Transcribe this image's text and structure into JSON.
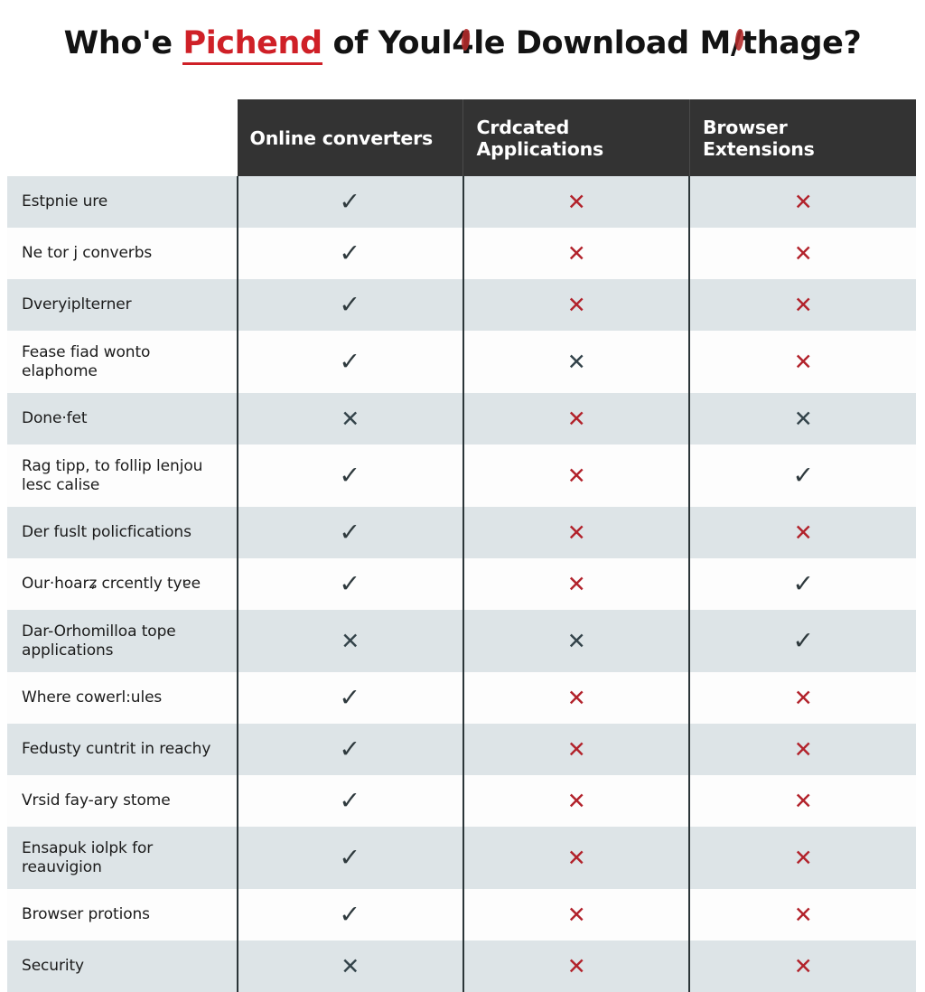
{
  "title": {
    "before": "Who'e ",
    "highlight": "Pichend",
    "middle": " of Youl",
    "smudge1": "4",
    "middle2": "le Download M",
    "smudge2": "/",
    "after": "thage?"
  },
  "table": {
    "columns": [
      {
        "id": "online-converters",
        "label": "Online converters"
      },
      {
        "id": "dedicated-applications",
        "label": "Crdcated Applications"
      },
      {
        "id": "browser-extensions",
        "label": "Browser Extensions"
      }
    ],
    "marks": {
      "check": "✓",
      "cross": "✕"
    },
    "colors": {
      "header_bg": "#333333",
      "row_alt_bg": "#dde4e7",
      "row_bg": "#fdfdfd",
      "cross_red": "#b2222b",
      "cross_dark": "#33434a",
      "check_dark": "#2e393d",
      "title_highlight": "#cf2027"
    },
    "rows": [
      {
        "label": "Estpnie ure",
        "values": [
          "check",
          "cross-red",
          "cross-red"
        ],
        "lines": 1
      },
      {
        "label": "Ne tor j converbs",
        "values": [
          "check",
          "cross-red",
          "cross-red"
        ],
        "lines": 1
      },
      {
        "label": "Dveryiplterner",
        "values": [
          "check",
          "cross-red",
          "cross-red"
        ],
        "lines": 1
      },
      {
        "label": "Fease fiad wonto elaphome",
        "values": [
          "check",
          "cross-dark",
          "cross-red"
        ],
        "lines": 2
      },
      {
        "label": "Done·fet",
        "values": [
          "cross-dark",
          "cross-red",
          "cross-dark"
        ],
        "lines": 1
      },
      {
        "label": "Rag tipp, to follip lenjou lesc calise",
        "values": [
          "check",
          "cross-red",
          "check"
        ],
        "lines": 2
      },
      {
        "label": "Der fuslt policfications",
        "values": [
          "check",
          "cross-red",
          "cross-red"
        ],
        "lines": 1
      },
      {
        "label": "Our·hoarʑ crcently tyɐe",
        "values": [
          "check",
          "cross-red",
          "check"
        ],
        "lines": 1
      },
      {
        "label": "Dar-Orhomilloa tope applications",
        "values": [
          "cross-dark",
          "cross-dark",
          "check"
        ],
        "lines": 2
      },
      {
        "label": "Where cowerl:ules",
        "values": [
          "check",
          "cross-red",
          "cross-red"
        ],
        "lines": 1
      },
      {
        "label": "Fedusty cuntrit in reachy",
        "values": [
          "check",
          "cross-red",
          "cross-red"
        ],
        "lines": 1
      },
      {
        "label": "Vrsid fay-ary stome",
        "values": [
          "check",
          "cross-red",
          "cross-red"
        ],
        "lines": 1
      },
      {
        "label": "Ensapuk iolpk for reauvigion",
        "values": [
          "check",
          "cross-red",
          "cross-red"
        ],
        "lines": 2
      },
      {
        "label": "Browser protions",
        "values": [
          "check",
          "cross-red",
          "cross-red"
        ],
        "lines": 1
      },
      {
        "label": "Security",
        "values": [
          "cross-dark",
          "cross-red",
          "cross-red"
        ],
        "lines": 1
      }
    ]
  }
}
